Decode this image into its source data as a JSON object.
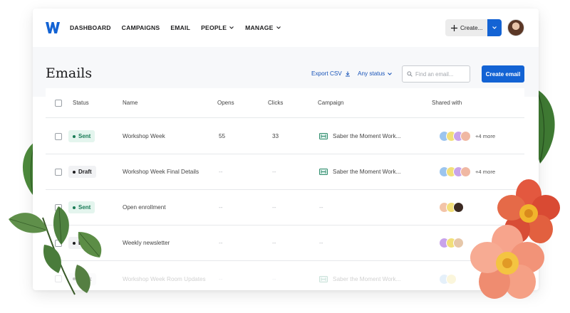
{
  "nav": {
    "items": [
      {
        "label": "DASHBOARD",
        "dropdown": false
      },
      {
        "label": "CAMPAIGNS",
        "dropdown": false
      },
      {
        "label": "EMAIL",
        "dropdown": false
      },
      {
        "label": "PEOPLE",
        "dropdown": true
      },
      {
        "label": "MANAGE",
        "dropdown": true
      }
    ],
    "create_label": "Create..."
  },
  "page": {
    "title": "Emails",
    "export_label": "Export CSV",
    "status_filter_label": "Any status",
    "search_placeholder": "Find an email...",
    "create_email_label": "Create email"
  },
  "table": {
    "columns": [
      "Status",
      "Name",
      "Opens",
      "Clicks",
      "Campaign",
      "Shared with"
    ],
    "rows": [
      {
        "status": "Sent",
        "name": "Workshop Week",
        "opens": "55",
        "clicks": "33",
        "campaign": "Saber the Moment Work...",
        "shared_count": 4,
        "more": "+4 more"
      },
      {
        "status": "Draft",
        "name": "Workshop Week Final Details",
        "opens": "--",
        "clicks": "--",
        "campaign": "Saber the Moment Work...",
        "shared_count": 4,
        "more": "+4 more"
      },
      {
        "status": "Sent",
        "name": "Open enrollment",
        "opens": "--",
        "clicks": "--",
        "campaign": "--",
        "shared_count": 3,
        "more": ""
      },
      {
        "status": "Draft",
        "name": "Weekly newsletter",
        "opens": "--",
        "clicks": "--",
        "campaign": "--",
        "shared_count": 3,
        "more": ""
      },
      {
        "status": "Draft",
        "name": "Workshop Week Room Updates",
        "opens": "--",
        "clicks": "--",
        "campaign": "Saber the Moment Work...",
        "shared_count": 2,
        "more": ""
      }
    ]
  },
  "colors": {
    "accent": "#1363d4",
    "link": "#1753b8",
    "sent_bg": "#e4f5ee",
    "sent_text": "#187a55",
    "draft_bg": "#f1f2f4",
    "draft_text": "#1d1d1f"
  },
  "icons": {
    "logo": "brand-w-logo",
    "create": "sparkle-icon",
    "export": "download-icon",
    "search": "search-icon",
    "campaign": "campaign-icon"
  }
}
